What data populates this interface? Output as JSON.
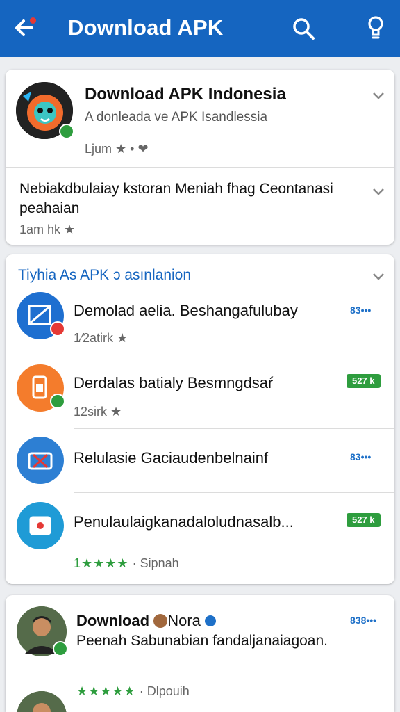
{
  "appbar": {
    "title": "Download APK",
    "back_icon": "arrow-left-icon",
    "search_icon": "search-icon",
    "fav_icon": "lightbulb-icon"
  },
  "header_card": {
    "title": "Download APK Indonesia",
    "subtitle": "A donleada ve APK Isandlessia",
    "meta": "Ljum ★ • ❤",
    "description": "Nebiakdbulaiay kstoran Meniah fhag Ceontanasi peahaian",
    "description_meta": "1am hk ★"
  },
  "apps_section": {
    "title": "Tiyhia As APK ᴐ asınlanion",
    "items": [
      {
        "title": "Demolad aelia. Beshangafulubay",
        "meta": "1⁄2atirk ★",
        "tag": "83••• ",
        "tag_type": "blue"
      },
      {
        "title": "Derdalas batialy Besmngdsaŕ",
        "meta": "12sirk ★",
        "tag": "527 k",
        "tag_type": "green"
      },
      {
        "title": "Relulasie Gaciaudenbelnainf",
        "meta": "",
        "tag": "83•••",
        "tag_type": "blue"
      },
      {
        "title": "Penulaulaiɡkanadaloludnasalb...",
        "meta": "Sipnah",
        "rating": "1★★★★",
        "tag": "527 k",
        "tag_type": "green"
      }
    ]
  },
  "reviews_card": {
    "author": "Download",
    "author_suffix": "Nora",
    "review_text": "Peenah Sabunabian fandaljanaiagoan.",
    "tag": "838•••",
    "stars": "★★★★★",
    "meta": "Dlpouih"
  },
  "colors": {
    "primary": "#1565c0",
    "green": "#2e9d3e",
    "red": "#e53935"
  }
}
